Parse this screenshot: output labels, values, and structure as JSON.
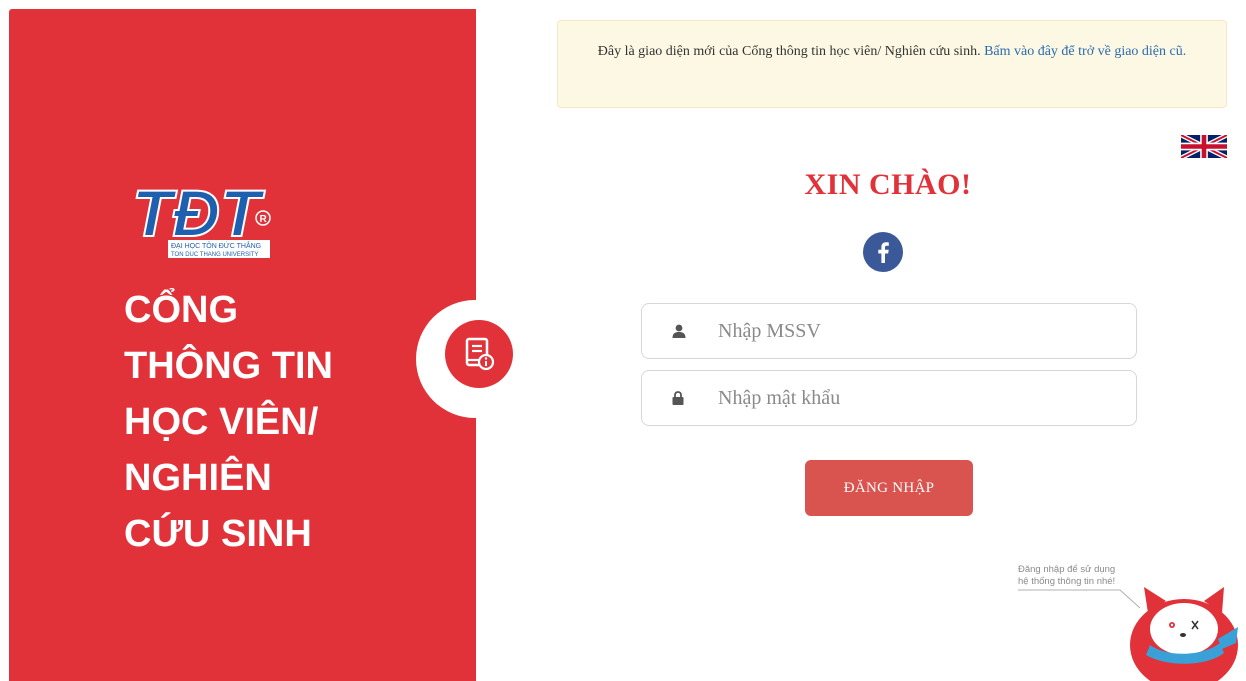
{
  "left_panel": {
    "logo": {
      "letters": "TĐT",
      "line1": "ĐẠI HỌC TÔN ĐỨC THẮNG",
      "line2": "TON DUC THANG UNIVERSITY"
    },
    "title_lines": [
      "CỔNG",
      "THÔNG TIN",
      "HỌC VIÊN/",
      "NGHIÊN",
      "CỨU SINH"
    ],
    "badge_icon": "book-info-icon"
  },
  "notice": {
    "text": "Đây là giao diện mới của Cổng thông tin học viên/ Nghiên cứu sinh.",
    "link_text": "Bấm vào đây để trở về giao diện cũ."
  },
  "language": {
    "icon": "uk-flag-icon"
  },
  "greeting": "XIN CHÀO!",
  "facebook": {
    "icon": "facebook-icon",
    "color": "#3b5998"
  },
  "form": {
    "username": {
      "placeholder": "Nhập MSSV",
      "value": "",
      "icon": "user-icon"
    },
    "password": {
      "placeholder": "Nhập mật khẩu",
      "value": "",
      "icon": "lock-icon"
    },
    "login_label": "ĐĂNG NHẬP"
  },
  "mascot": {
    "caption_line1": "Đăng nhập để sử dụng",
    "caption_line2": "hệ thống thông tin nhé!"
  },
  "colors": {
    "brand_red": "#e1323a",
    "button_red": "#d9534f",
    "notice_bg": "#fcf8e3",
    "logo_blue": "#1f5fb0"
  }
}
